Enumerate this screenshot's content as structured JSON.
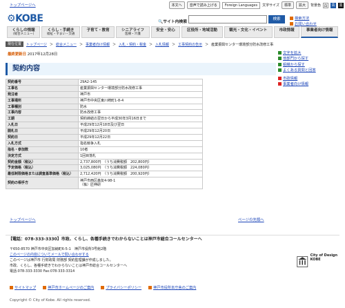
{
  "topbar": {
    "skip": "トップページへ",
    "utils": [
      "本文へ",
      "音声で読み上げる"
    ],
    "language": "Foreign Languages",
    "font_size_label": "文字サイズ",
    "font_size_current": "標準",
    "zoom_in": "拡大",
    "bg_color_label": "背景色",
    "bg_colors": [
      "白",
      "青",
      "黒"
    ]
  },
  "header": {
    "logo": "KOBE",
    "search_label": "サイト内検索",
    "search_button": "検索",
    "search_links": [
      "検索方法",
      "お問い合わせ"
    ]
  },
  "nav": [
    {
      "label": "くらしの情報",
      "sub": "(総合メニュー)"
    },
    {
      "label": "くらし・手続き",
      "sub": "福祉・すまい・交通"
    },
    {
      "label": "子育て・教育",
      "sub": ""
    },
    {
      "label": "シニアライフ",
      "sub": "医療・介護"
    },
    {
      "label": "安全・安心",
      "sub": ""
    },
    {
      "label": "区役所・地域活動",
      "sub": ""
    },
    {
      "label": "観光・文化・イベント",
      "sub": ""
    },
    {
      "label": "市政情報",
      "sub": ""
    },
    {
      "label": "事業者向け情報",
      "sub": ""
    }
  ],
  "breadcrumb": {
    "label": "現在位置",
    "items": [
      "トップページ",
      "総合メニュー",
      "事業者向け情報",
      "入札・契約・税金",
      "入札情報",
      "工事契約の告示",
      "産業振興センター環境部分防水改修工事"
    ]
  },
  "updated": {
    "label": "最終更新日",
    "date": "2017年12月28日"
  },
  "title": "契約内容",
  "side": [
    "文字を拡大",
    "他部門から探す",
    "組織から探す",
    "よくある質問と回答",
    "市政情報",
    "事業者向け情報"
  ],
  "table": [
    [
      "契約番号",
      "29A2-145"
    ],
    [
      "工事名",
      "産業振興センター環境部分防水改修工事"
    ],
    [
      "発注者",
      "神戸市"
    ],
    [
      "工事場所",
      "神戸市中央区東川崎町1-8-4"
    ],
    [
      "工事種別",
      "防水"
    ],
    [
      "工事内容",
      "防水改修工事"
    ],
    [
      "工期",
      "契約締結の翌日から平成30年3月16日まで"
    ],
    [
      "入札日",
      "平成29年12月18日及び翌日"
    ],
    [
      "開札日",
      "平成29年12月20日"
    ],
    [
      "契約日",
      "平成29年12月22日"
    ],
    [
      "入札方式",
      "指名競争入札"
    ],
    [
      "指名・参加数",
      "10者"
    ],
    [
      "決定方式",
      "1回目落札"
    ],
    [
      "契約金額（税込）",
      "2,737,800円　（うち消費税額　202,800円）"
    ],
    [
      "予定価格（税込）",
      "3,025,080円　（うち消費税額　224,080円）"
    ],
    [
      "最低制限価格または調査基準価格（税込）",
      "2,712,420円　（うち消費税額　200,920円）"
    ],
    [
      "契約の相手方",
      "神戸市西区森友4-98-1\n（株）匠伸研"
    ]
  ],
  "bottom": {
    "top_link_left": "トップページへ",
    "top_link_right": "ページの先頭へ",
    "callbar": "【電話：078-333-3330】市政、くらし、各種手続きでわからないことは神戸市総合コールセンターへ",
    "footer_lines": [
      "〒650-8570 神戸市中央区加納町6-5-1　神戸市役所3号館2階",
      "このページの内容についてメールで問い合わせする",
      "このページは神戸市 行財政局 財務部 契約監理課が作成しました。",
      "市政、くらし、各種手続きでわからないことは神戸市総合コールセンターへ",
      "電話:078-333-3330 Fax:078-333-3314"
    ],
    "unesco": "City of Design KOBE",
    "footer_links": [
      "サイトマップ",
      "神戸市ホームページのご案内",
      "プライバシーポリシー",
      "神戸市役所本庁舎のご案内"
    ],
    "copyright": "Copyright © City of Kobe. All rights reserved."
  }
}
